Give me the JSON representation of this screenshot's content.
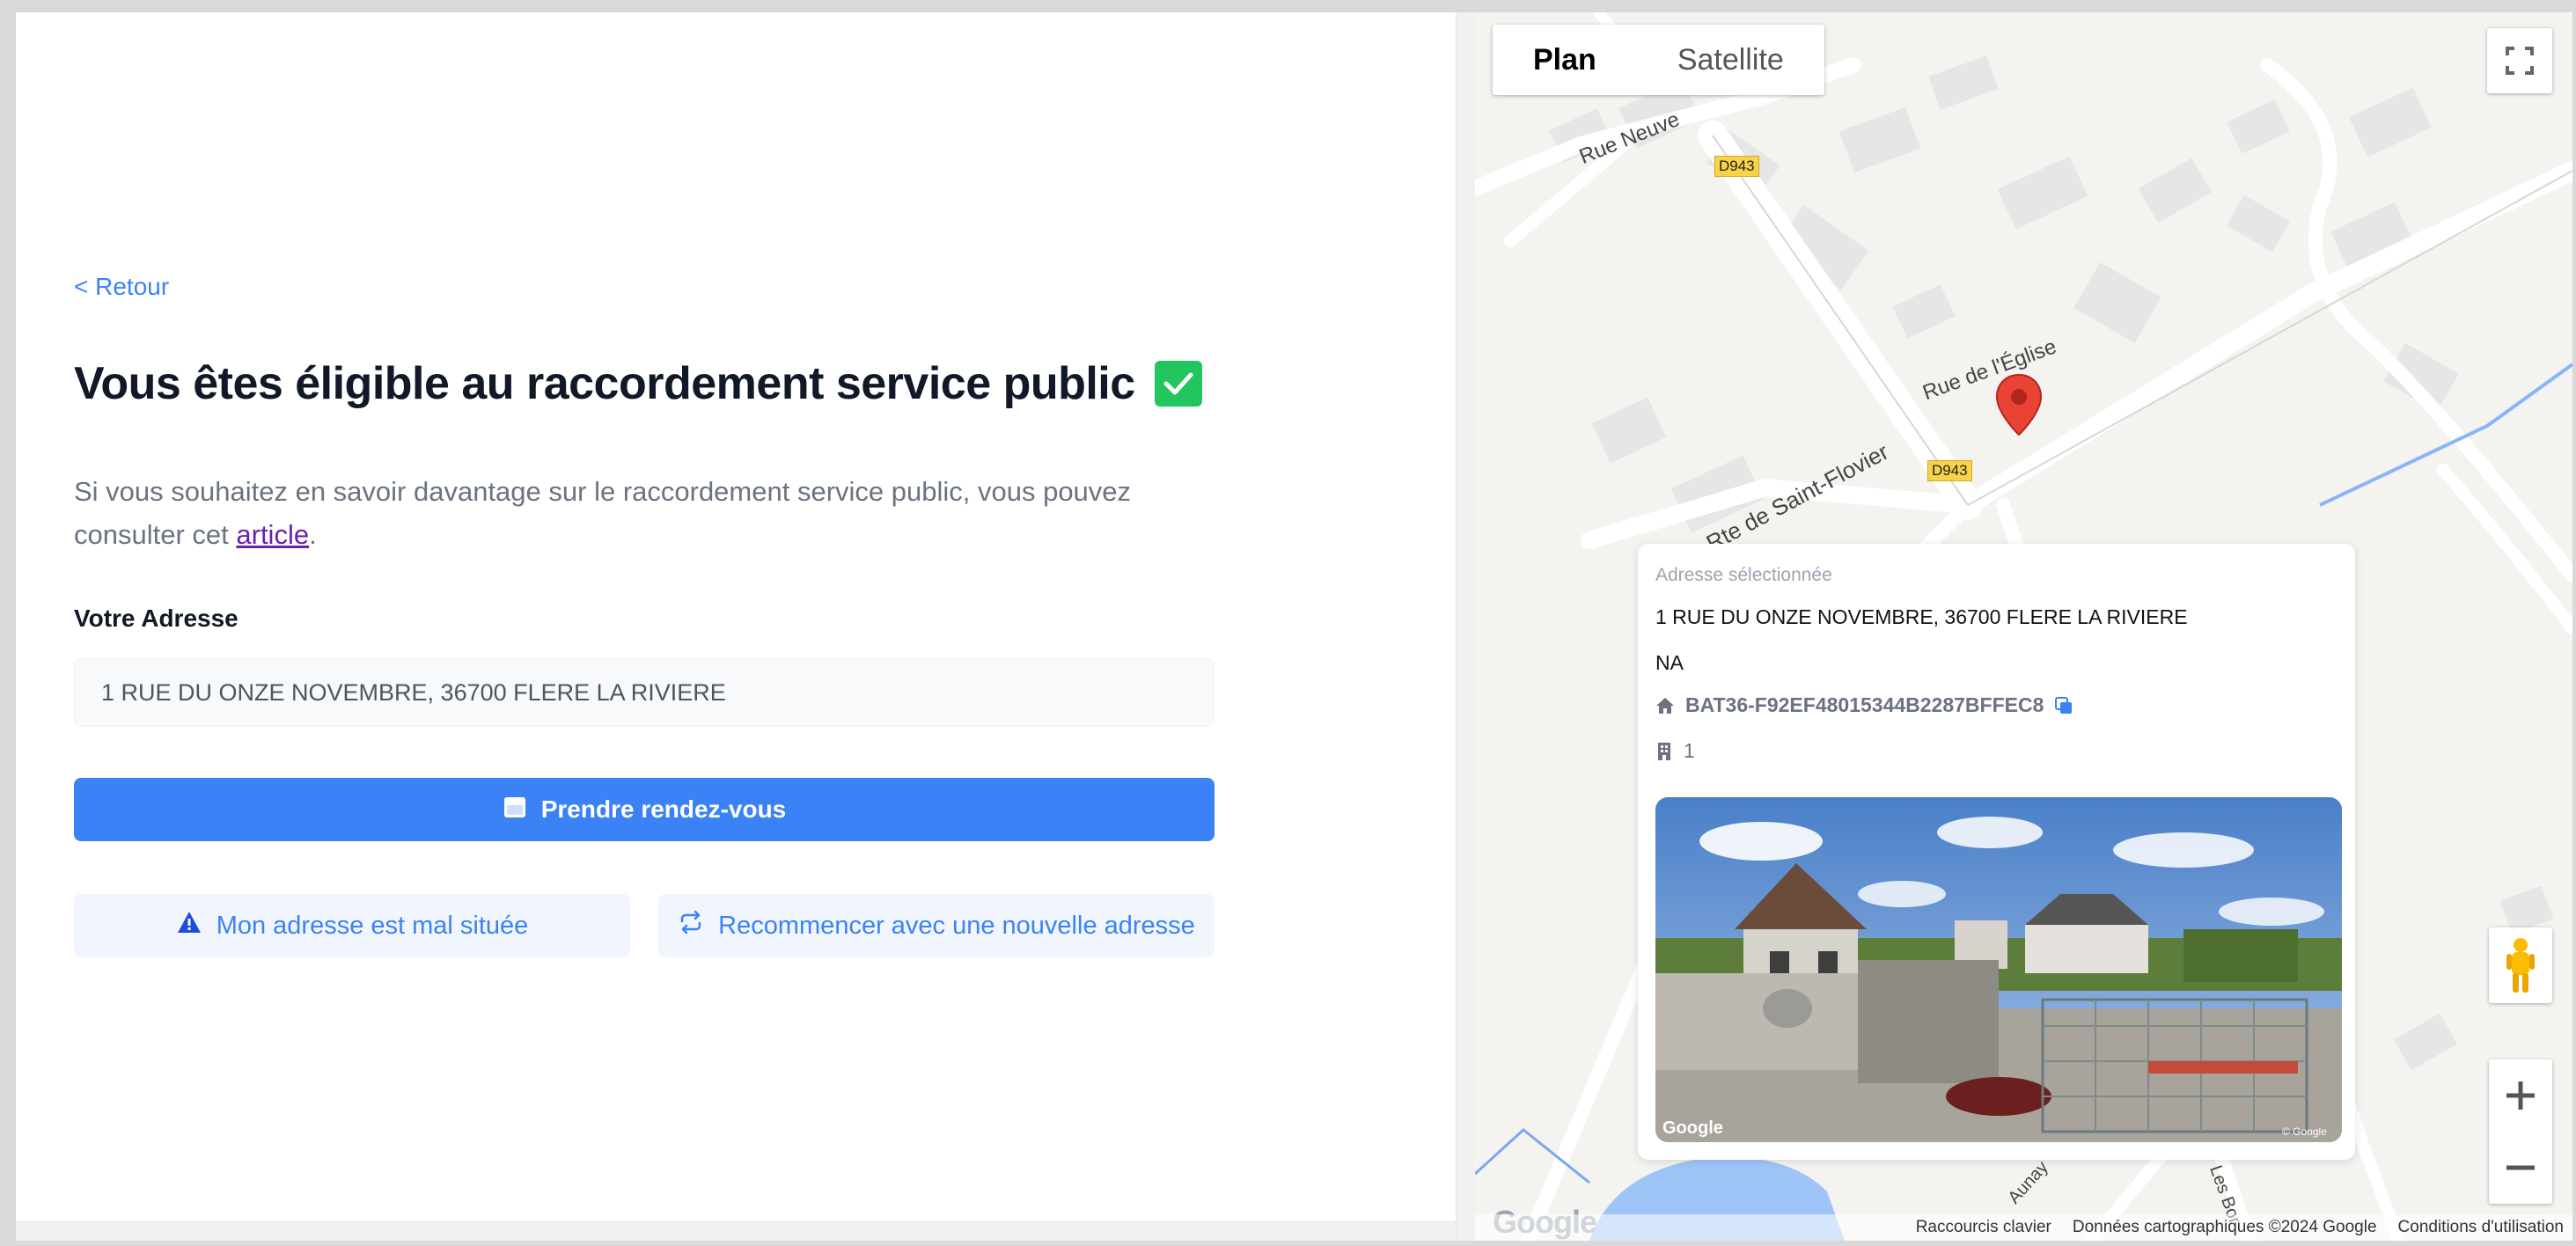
{
  "left": {
    "back_link": "< Retour",
    "title": "Vous êtes éligible au raccordement service public",
    "description_text": "Si vous souhaitez en savoir davantage sur le raccordement service public, vous pouvez consulter cet ",
    "description_link": "article",
    "description_end": ".",
    "address_label": "Votre Adresse",
    "address_value": "1 RUE DU ONZE NOVEMBRE, 36700 FLERE LA RIVIERE",
    "primary_button": "Prendre rendez-vous",
    "misplaced_button": "Mon adresse est mal située",
    "restart_button": "Recommencer avec une nouvelle adresse"
  },
  "map": {
    "tabs": [
      "Plan",
      "Satellite"
    ],
    "labels": {
      "rue_neuve": "Rue Neuve",
      "rue_eglise": "Rue de l'Église",
      "rte_flovier": "Rte de Saint-Flovier",
      "d943": "D943",
      "d943b": "D943",
      "aunay": "Aunay",
      "les_bor": "Les Bor"
    },
    "footer": {
      "shortcuts": "Raccourcis clavier",
      "data": "Données cartographiques ©2024 Google",
      "terms": "Conditions d'utilisation"
    },
    "logo": "Google"
  },
  "card": {
    "label": "Adresse sélectionnée",
    "address": "1 RUE DU ONZE NOVEMBRE, 36700 FLERE LA RIVIERE",
    "na": "NA",
    "building_id": "BAT36-F92EF48015344B2287BFFEC8",
    "count": "1",
    "photo_logo": "Google",
    "photo_copyright": "© Google"
  },
  "colors": {
    "primary": "#3b82f6",
    "success": "#22c55e",
    "marker": "#ea4335"
  }
}
